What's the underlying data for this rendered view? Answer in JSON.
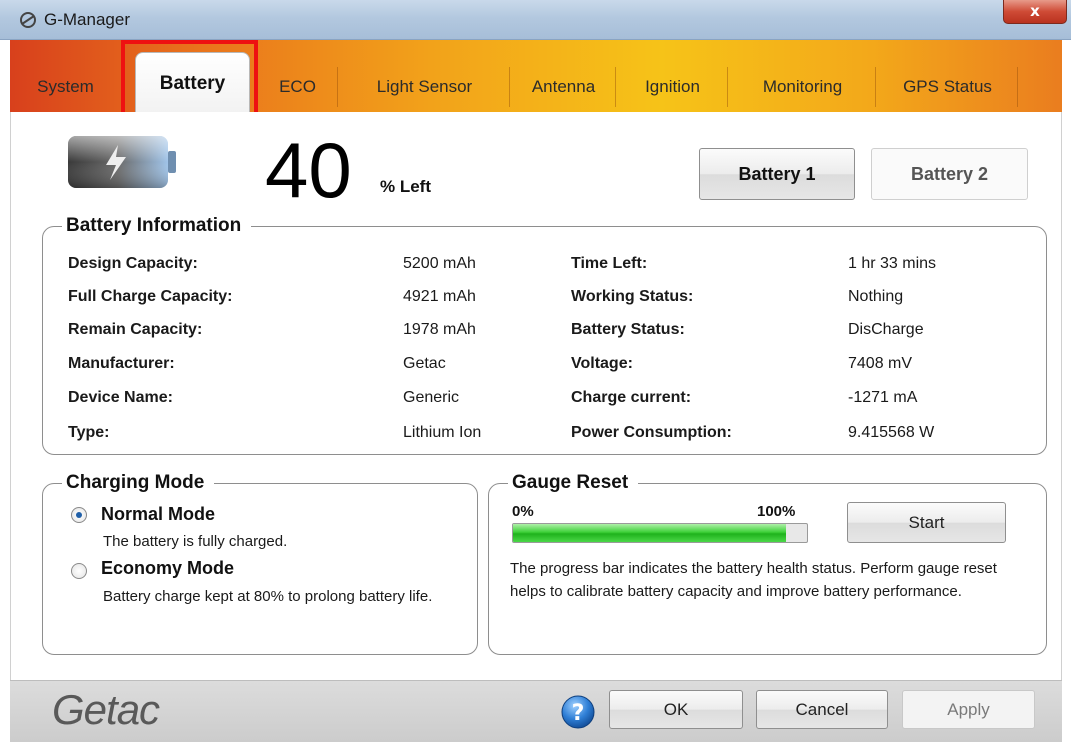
{
  "window": {
    "title": "G-Manager",
    "close_label": "x"
  },
  "tabs": [
    {
      "label": "System"
    },
    {
      "label": "Battery",
      "active": true
    },
    {
      "label": "ECO"
    },
    {
      "label": "Light Sensor"
    },
    {
      "label": "Antenna"
    },
    {
      "label": "Ignition"
    },
    {
      "label": "Monitoring"
    },
    {
      "label": "GPS Status"
    }
  ],
  "battery": {
    "percent": "40",
    "percent_suffix": "% Left",
    "battery1_label": "Battery 1",
    "battery2_label": "Battery 2"
  },
  "info": {
    "title": "Battery Information",
    "left": [
      {
        "label": "Design Capacity:",
        "value": "5200 mAh"
      },
      {
        "label": "Full Charge Capacity:",
        "value": "4921 mAh"
      },
      {
        "label": "Remain Capacity:",
        "value": "1978 mAh"
      },
      {
        "label": "Manufacturer:",
        "value": "Getac"
      },
      {
        "label": "Device Name:",
        "value": "Generic"
      },
      {
        "label": "Type:",
        "value": "Lithium Ion"
      }
    ],
    "right": [
      {
        "label": "Time Left:",
        "value": "1 hr 33 mins"
      },
      {
        "label": "Working Status:",
        "value": "Nothing"
      },
      {
        "label": "Battery Status:",
        "value": "DisCharge"
      },
      {
        "label": "Voltage:",
        "value": "7408 mV"
      },
      {
        "label": "Charge current:",
        "value": "-1271 mA"
      },
      {
        "label": "Power Consumption:",
        "value": "9.415568 W"
      }
    ]
  },
  "charging_mode": {
    "title": "Charging Mode",
    "normal_label": "Normal Mode",
    "normal_desc": "The battery is fully charged.",
    "economy_label": "Economy Mode",
    "economy_desc": "Battery charge kept at 80% to prolong battery life.",
    "selected": "normal"
  },
  "gauge_reset": {
    "title": "Gauge Reset",
    "min_label": "0%",
    "max_label": "100%",
    "progress_fraction": 0.93,
    "start_label": "Start",
    "desc": "The progress bar indicates the battery health status. Perform gauge reset helps to calibrate battery capacity and improve battery performance."
  },
  "footer": {
    "logo_text": "Getac",
    "ok_label": "OK",
    "cancel_label": "Cancel",
    "apply_label": "Apply"
  },
  "colors": {
    "close_red": "#cf4b36",
    "tab_orange": "#f2a21a",
    "highlight_red": "#ee1111",
    "progress_green": "#3fd13a"
  }
}
